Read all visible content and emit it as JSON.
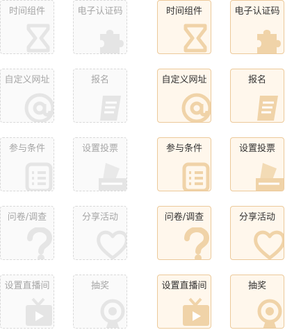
{
  "colors": {
    "on_border": "#ecc99a",
    "on_fill": "#fff7ec",
    "on_icon": "#f0d3a8",
    "off_border": "#d8d8d8",
    "off_icon": "#e5e5e5"
  },
  "inactive": [
    {
      "label": "时间组件",
      "icon": "hourglass-icon"
    },
    {
      "label": "电子认证码",
      "icon": "puzzle-icon"
    },
    {
      "label": "自定义网址",
      "icon": "at-sign-icon"
    },
    {
      "label": "报名",
      "icon": "scroll-icon"
    },
    {
      "label": "参与条件",
      "icon": "checklist-icon"
    },
    {
      "label": "设置投票",
      "icon": "ballot-box-icon"
    },
    {
      "label": "问卷/调查",
      "icon": "question-mark-icon"
    },
    {
      "label": "分享活动",
      "icon": "heart-icon"
    },
    {
      "label": "设置直播间",
      "icon": "tv-icon"
    },
    {
      "label": "抽奖",
      "icon": "prize-icon"
    }
  ],
  "active": [
    {
      "label": "时间组件",
      "icon": "hourglass-icon"
    },
    {
      "label": "电子认证码",
      "icon": "puzzle-icon"
    },
    {
      "label": "自定义网址",
      "icon": "at-sign-icon"
    },
    {
      "label": "报名",
      "icon": "scroll-icon"
    },
    {
      "label": "参与条件",
      "icon": "checklist-icon"
    },
    {
      "label": "设置投票",
      "icon": "ballot-box-icon"
    },
    {
      "label": "问卷/调查",
      "icon": "question-mark-icon"
    },
    {
      "label": "分享活动",
      "icon": "heart-icon"
    },
    {
      "label": "设置直播间",
      "icon": "tv-icon"
    },
    {
      "label": "抽奖",
      "icon": "prize-icon"
    }
  ]
}
